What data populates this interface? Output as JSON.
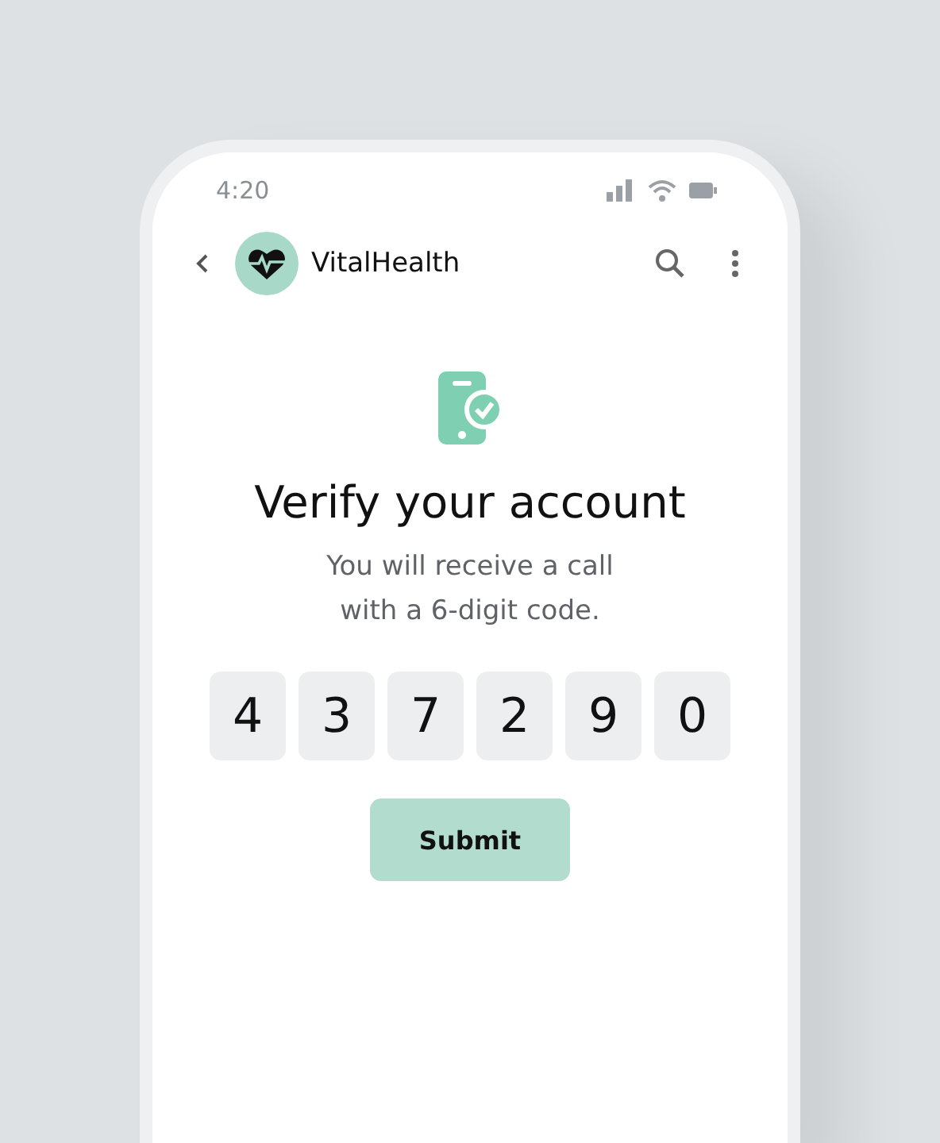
{
  "status_bar": {
    "time": "4:20"
  },
  "app_bar": {
    "title": "VitalHealth"
  },
  "verify": {
    "title": "Verify your account",
    "message": "You will receive a call\nwith a 6-digit code."
  },
  "code_digits": [
    "4",
    "3",
    "7",
    "2",
    "9",
    "0"
  ],
  "submit_button": {
    "label": "Submit"
  }
}
